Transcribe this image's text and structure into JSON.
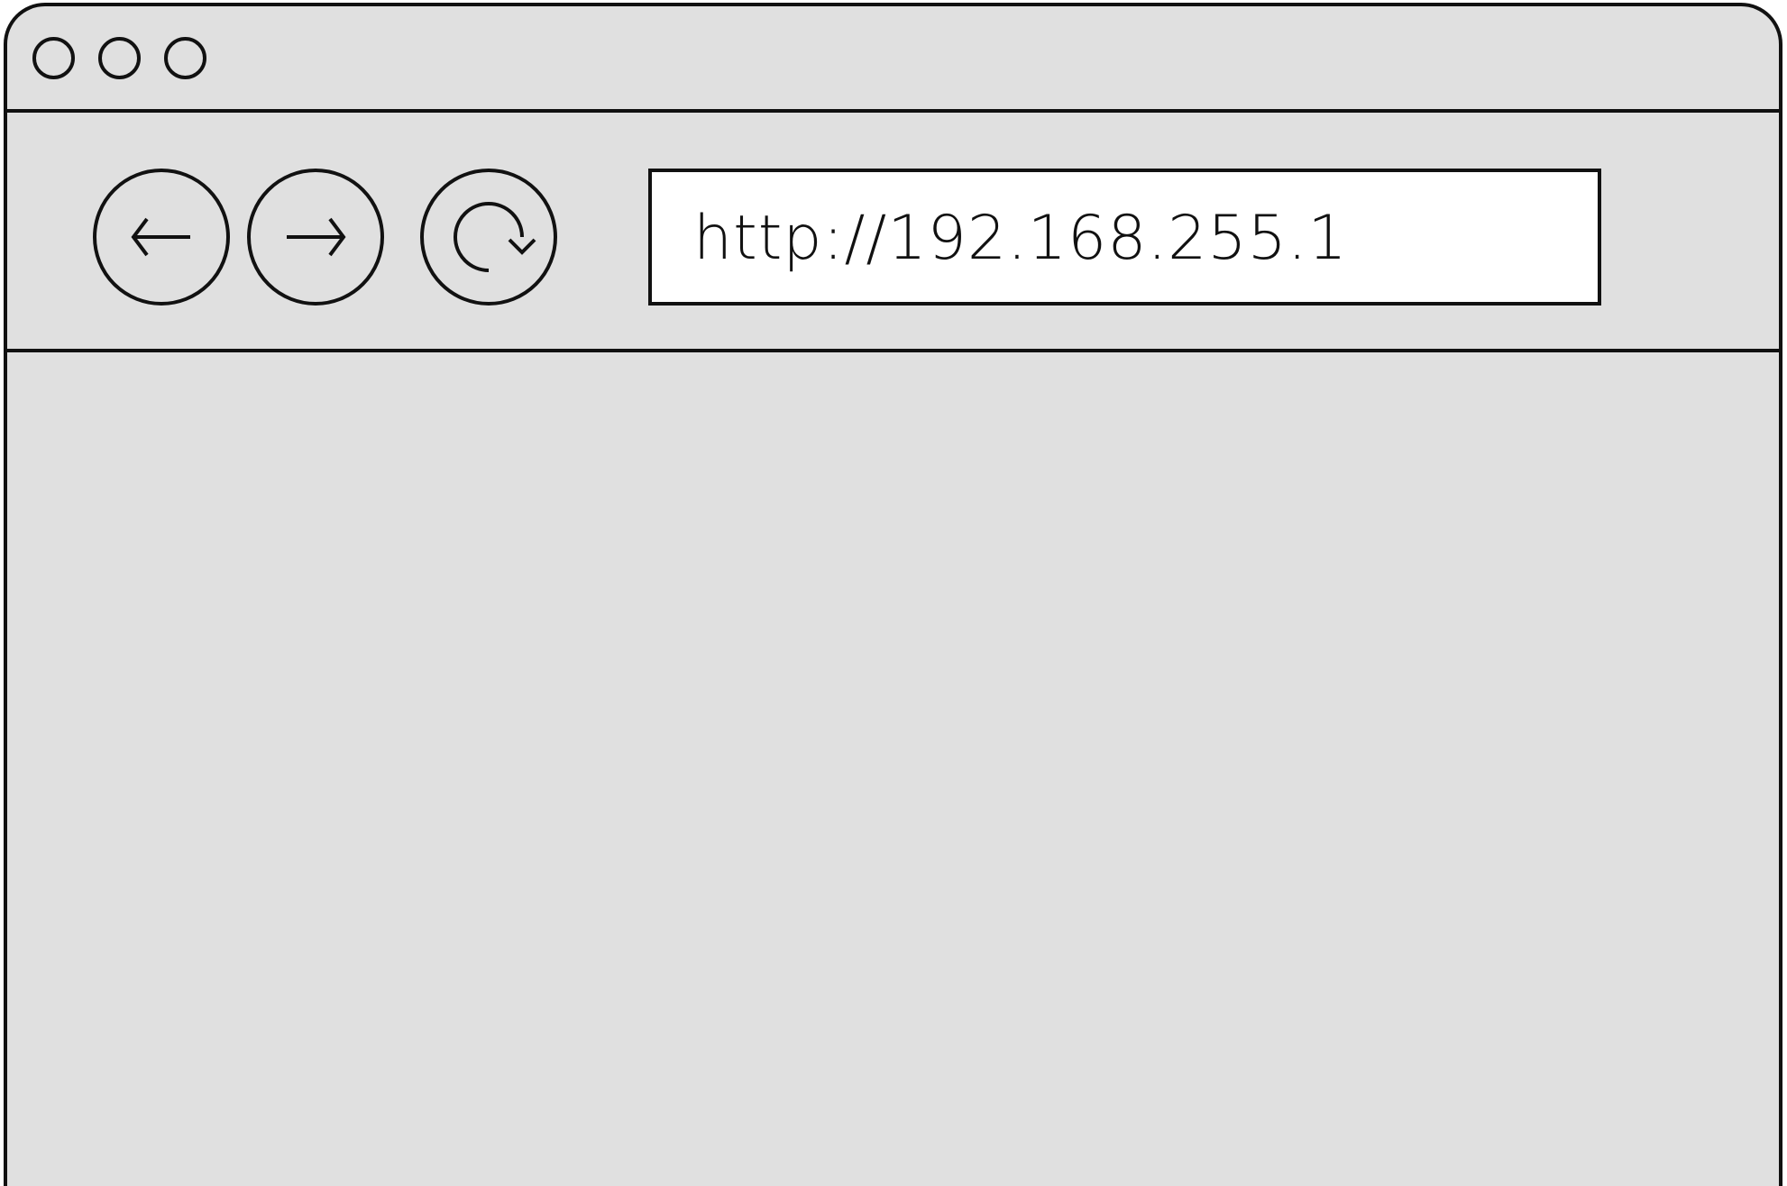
{
  "window": {
    "background_color": "#e0e0e0",
    "outline_color": "#111111"
  },
  "titlebar": {
    "controls": [
      {
        "name": "close",
        "icon": "circle-outline-icon"
      },
      {
        "name": "minimize",
        "icon": "circle-outline-icon"
      },
      {
        "name": "maximize",
        "icon": "circle-outline-icon"
      }
    ]
  },
  "toolbar": {
    "back": {
      "icon": "arrow-left-icon"
    },
    "forward": {
      "icon": "arrow-right-icon"
    },
    "reload": {
      "icon": "reload-icon"
    },
    "address": {
      "value": "http://192.168.255.1",
      "background_color": "#ffffff"
    }
  },
  "content": {}
}
